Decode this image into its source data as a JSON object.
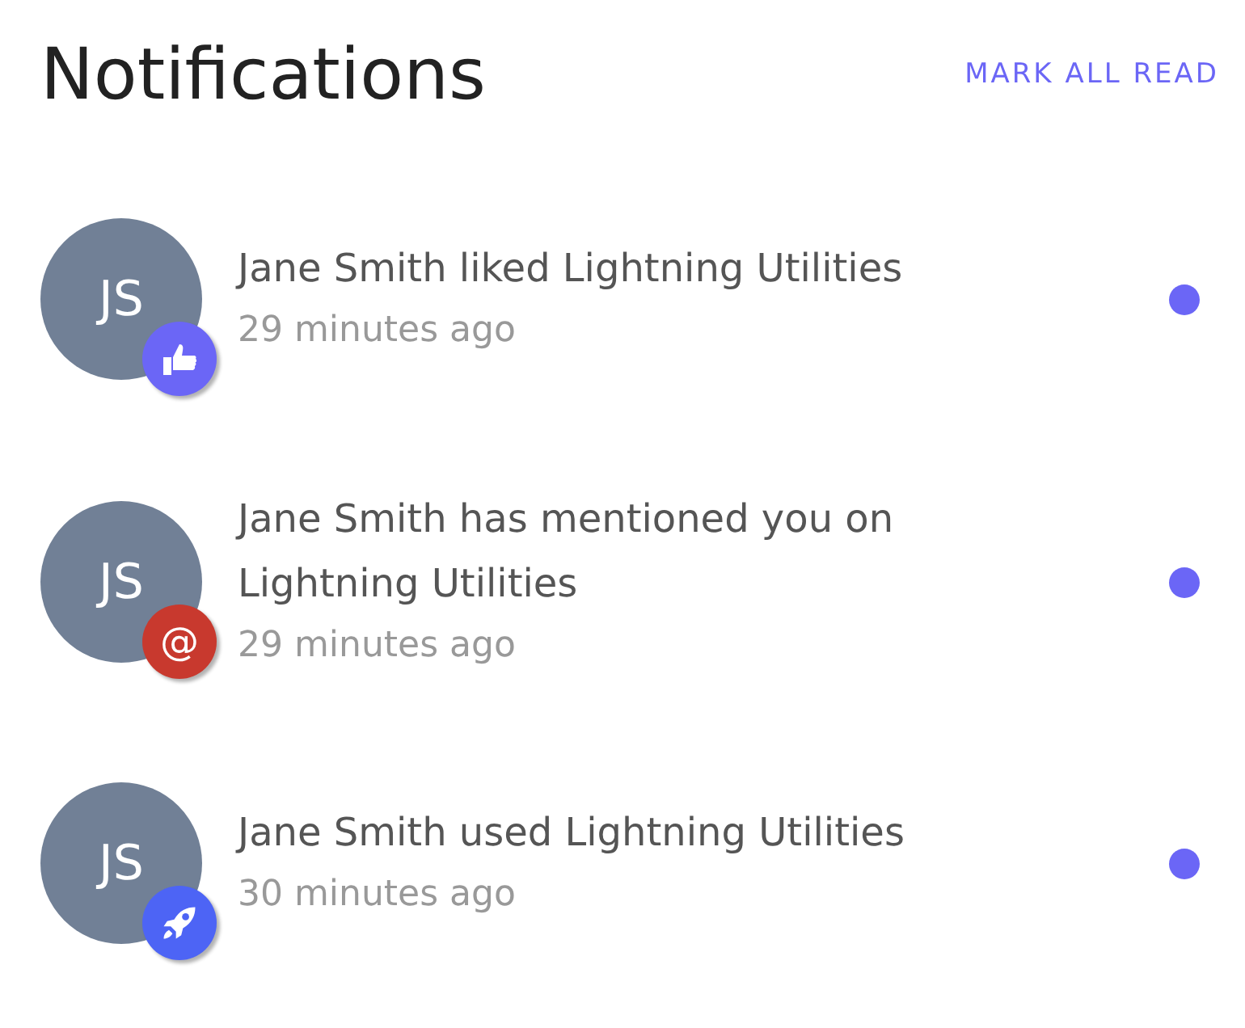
{
  "header": {
    "title": "Notifications",
    "action": "MARK ALL READ"
  },
  "notifications": [
    {
      "initials": "JS",
      "kind": "like",
      "color": "#6b66f6",
      "message": "Jane Smith liked Lightning Utilities",
      "time": "29 minutes ago",
      "unread": true
    },
    {
      "initials": "JS",
      "kind": "mention",
      "color": "#c8392e",
      "symbol": "@",
      "message": "Jane Smith has mentioned you on Lightning Utilities",
      "time": "29 minutes ago",
      "unread": true
    },
    {
      "initials": "JS",
      "kind": "use",
      "color": "#4d64f5",
      "message": "Jane Smith used Lightning Utilities",
      "time": "30 minutes ago",
      "unread": true
    }
  ]
}
